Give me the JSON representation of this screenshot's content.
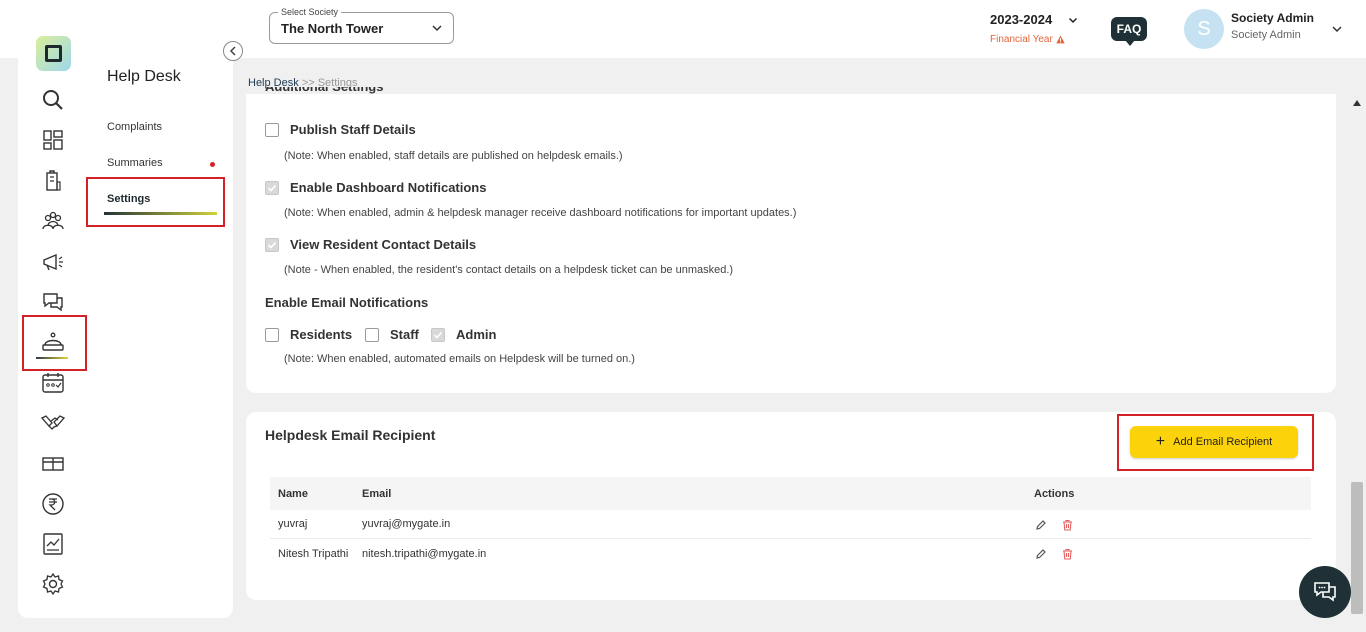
{
  "header": {
    "society_select_label": "Select Society",
    "society_select_value": "The North Tower",
    "financial_year": "2023-2024",
    "financial_year_label": "Financial Year",
    "faq_label": "FAQ",
    "user_initial": "S",
    "user_name": "Society Admin",
    "user_role": "Society Admin"
  },
  "sidebar": {
    "section_title": "Help Desk",
    "items": [
      {
        "label": "Complaints"
      },
      {
        "label": "Summaries"
      },
      {
        "label": "Settings"
      }
    ]
  },
  "breadcrumb": {
    "current": "Help Desk",
    "rest": ">> Settings"
  },
  "settings": {
    "heading_cut": "Additional Settings",
    "publish_staff": {
      "label": "Publish Staff Details",
      "checked": false,
      "note": "(Note: When enabled, staff details are published on helpdesk emails.)"
    },
    "dashboard_notifications": {
      "label": "Enable Dashboard Notifications",
      "checked": true,
      "note": "(Note: When enabled, admin & helpdesk manager receive dashboard notifications for important updates.)"
    },
    "resident_contact": {
      "label": "View Resident Contact Details",
      "checked": true,
      "note": "(Note - When enabled, the resident's contact details on a helpdesk ticket can be unmasked.)"
    },
    "email_notifications": {
      "heading": "Enable Email Notifications",
      "residents": {
        "label": "Residents",
        "checked": false
      },
      "staff": {
        "label": "Staff",
        "checked": false
      },
      "admin": {
        "label": "Admin",
        "checked": true
      },
      "note": "(Note: When enabled, automated emails on Helpdesk will be turned on.)"
    }
  },
  "recipients": {
    "title": "Helpdesk Email Recipient",
    "add_button": "Add Email Recipient",
    "columns": {
      "name": "Name",
      "email": "Email",
      "actions": "Actions"
    },
    "rows": [
      {
        "name": "yuvraj",
        "email": "yuvraj@mygate.in"
      },
      {
        "name": "Nitesh Tripathi",
        "email": "nitesh.tripathi@mygate.in"
      }
    ]
  },
  "colors": {
    "accent_yellow": "#fcd20b",
    "dark": "#1f3137",
    "highlight_red": "#d42027",
    "warning_orange": "#e0663a"
  }
}
